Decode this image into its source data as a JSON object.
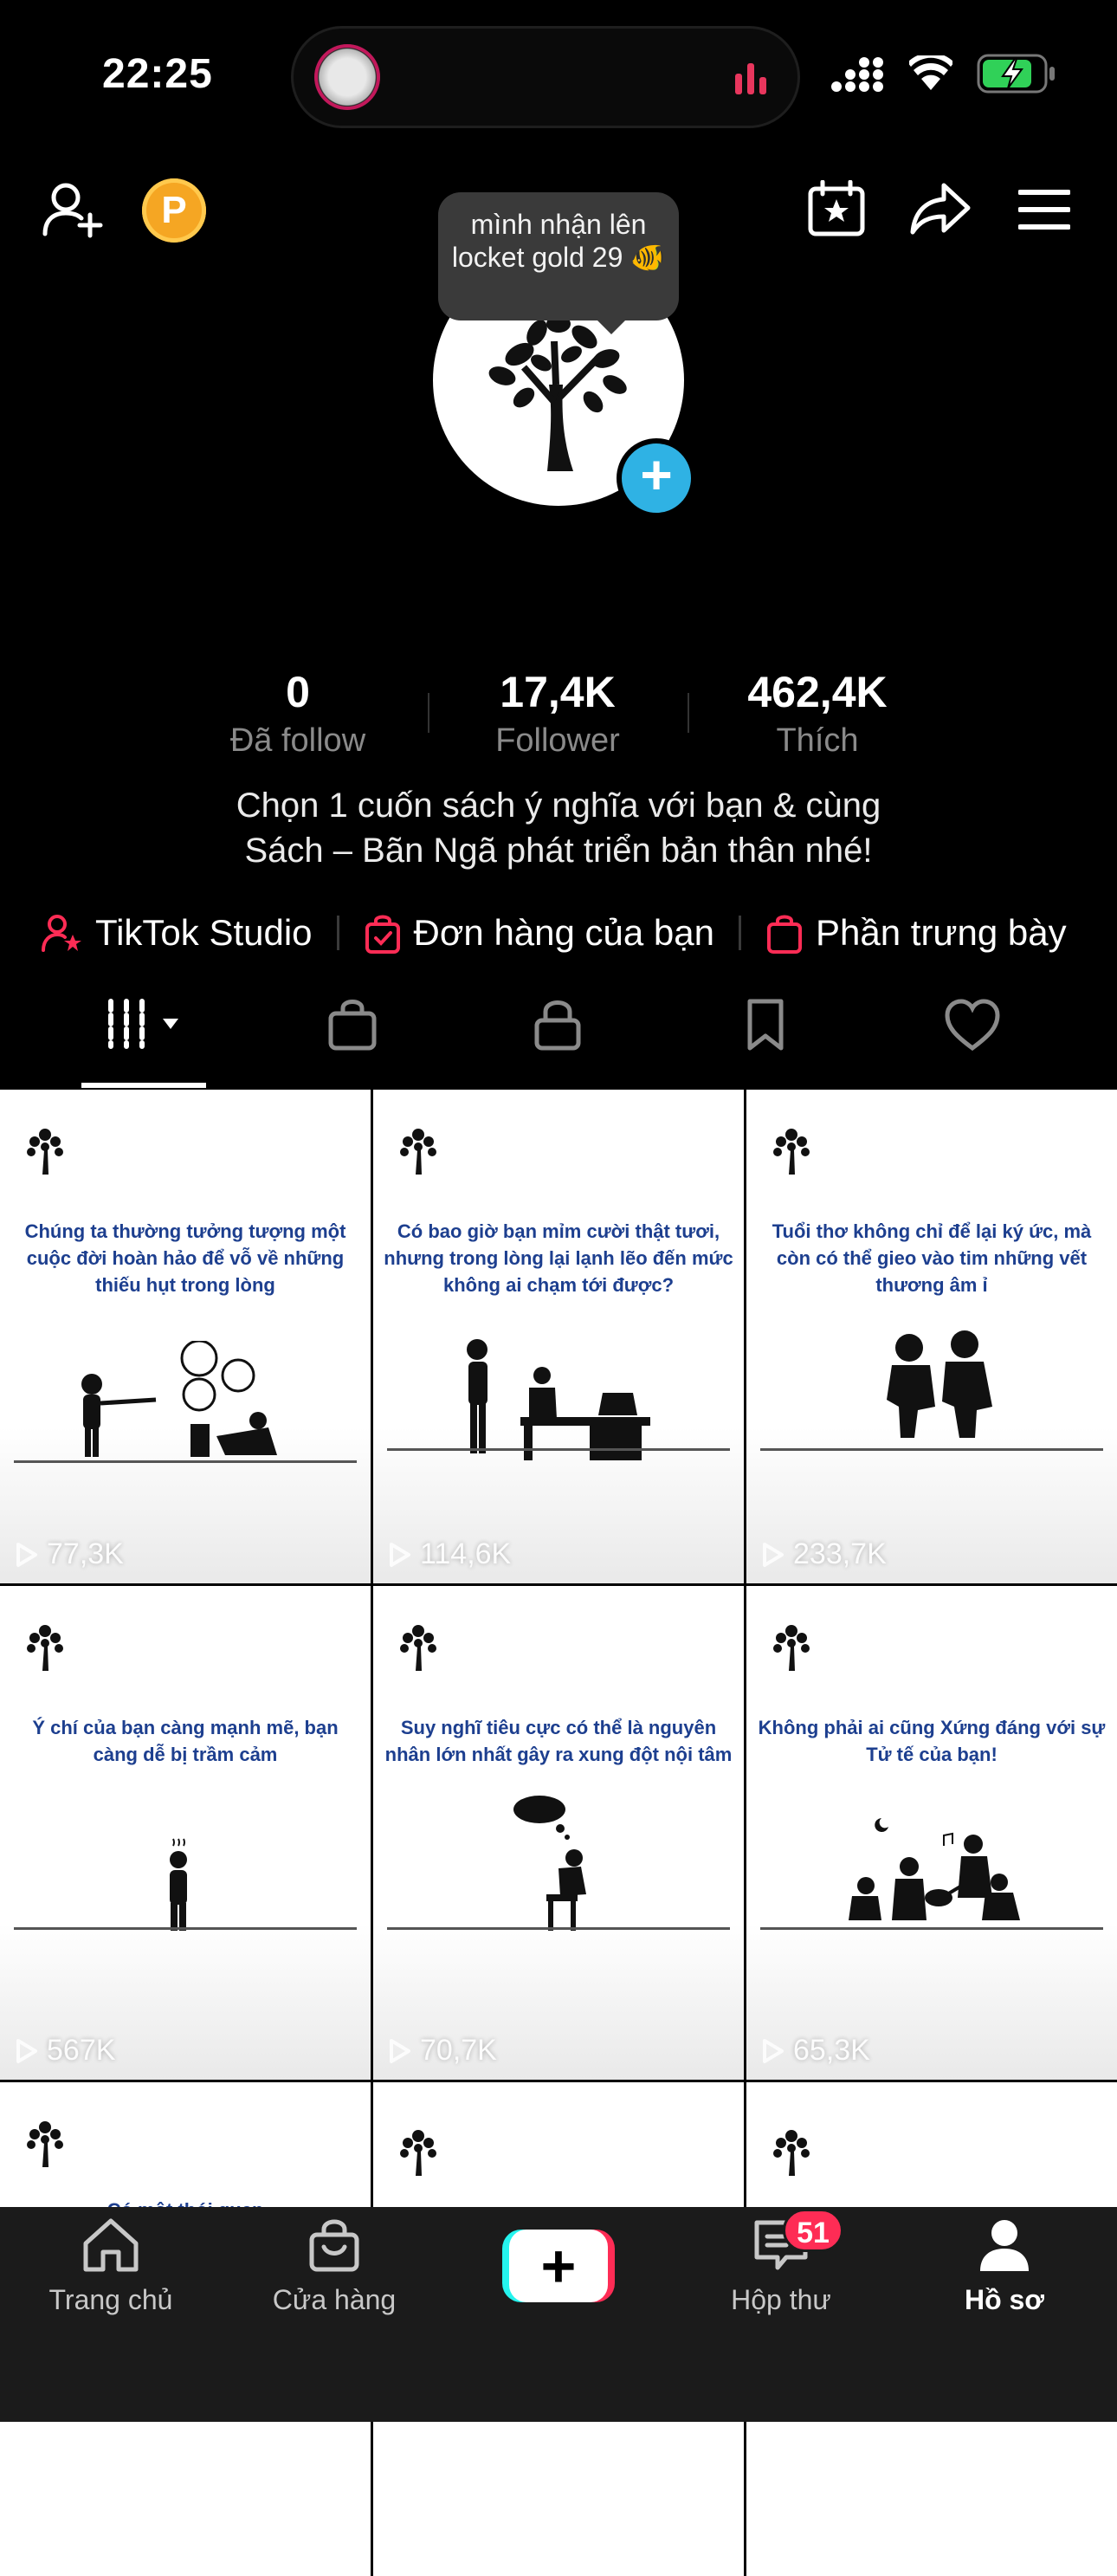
{
  "status_bar": {
    "time": "22:25"
  },
  "header": {
    "coin_letter": "P"
  },
  "profile": {
    "avatar_tooltip": "mình nhận lên locket gold 29 🐠",
    "stats": [
      {
        "value": "0",
        "label": "Đã follow"
      },
      {
        "value": "17,4K",
        "label": "Follower"
      },
      {
        "value": "462,4K",
        "label": "Thích"
      }
    ],
    "bio_line1": "Chọn 1 cuốn sách ý nghĩa với bạn & cùng",
    "bio_line2": "Sách – Bãn Ngã phát triển bản thân nhé!"
  },
  "links": [
    {
      "label": "TikTok Studio"
    },
    {
      "label": "Đơn hàng của bạn"
    },
    {
      "label": "Phần trưng bày"
    }
  ],
  "videos": [
    {
      "caption": "Chúng ta thường tưởng tượng một cuộc đời hoàn hảo để vỗ về những thiếu hụt trong lòng",
      "views": "77,3K"
    },
    {
      "caption": "Có bao giờ bạn mỉm cười thật tươi, nhưng trong lòng lại lạnh lẽo đến mức không ai chạm tới được?",
      "views": "114,6K"
    },
    {
      "caption": "Tuổi thơ không chỉ để lại ký ức, mà còn có thể gieo vào tim những vết thương âm ỉ",
      "views": "233,7K"
    },
    {
      "caption": "Ý chí của bạn càng mạnh mẽ, bạn càng dễ bị trầm cảm",
      "views": "567K"
    },
    {
      "caption": "Suy nghĩ tiêu cực có thể là nguyên nhân lớn nhất gây ra xung đột nội tâm",
      "views": "70,7K"
    },
    {
      "caption": "Không phải ai cũng Xứng đáng với sự Tử tế của bạn!",
      "views": "65,3K"
    },
    {
      "caption": "Có một thói quen",
      "views": ""
    },
    {
      "caption": "",
      "views": ""
    },
    {
      "caption": "",
      "views": ""
    }
  ],
  "bottom_nav": {
    "home": "Trang chủ",
    "shop": "Cửa hàng",
    "plus": "+",
    "inbox": "Hộp thư",
    "inbox_badge": "51",
    "profile": "Hồ sơ"
  },
  "colors": {
    "accent": "#fe2c55",
    "teal": "#25f4ee",
    "caption_blue": "#1d3f8f",
    "add_blue": "#2fb2e4"
  }
}
